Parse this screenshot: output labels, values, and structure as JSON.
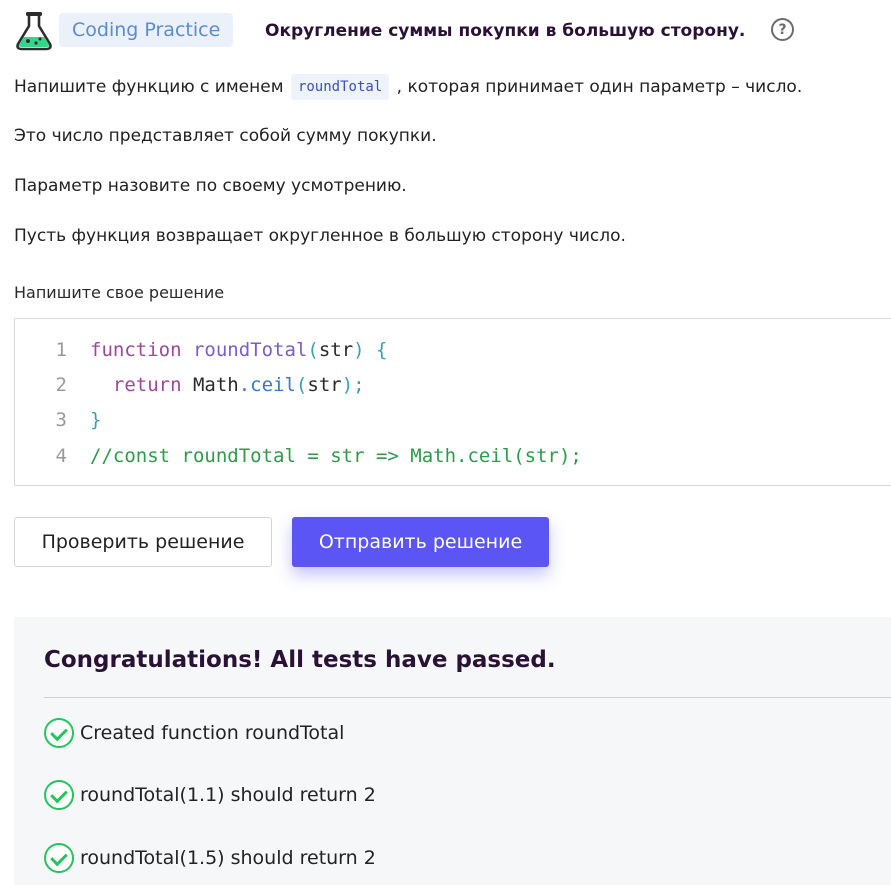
{
  "header": {
    "icon": "flask-icon",
    "tag": "Coding Practice",
    "title": "Округление суммы покупки в большую сторону.",
    "help": "?"
  },
  "description": {
    "line1_before": "Напишите функцию с именем",
    "line1_code": "roundTotal",
    "line1_after": ", которая принимает один параметр – число.",
    "line2": "Это число представляет собой сумму покупки.",
    "line3": "Параметр назовите по своему усмотрению.",
    "line4": "Пусть функция возвращает округленное в большую сторону число."
  },
  "editor": {
    "label": "Напишите свое решение",
    "lines": [
      {
        "num": "1",
        "tokens": [
          {
            "t": "function",
            "c": "kw"
          },
          {
            "t": " ",
            "c": "var"
          },
          {
            "t": "roundTotal",
            "c": "fn"
          },
          {
            "t": "(",
            "c": "pun"
          },
          {
            "t": "str",
            "c": "var"
          },
          {
            "t": ") {",
            "c": "pun"
          }
        ]
      },
      {
        "num": "2",
        "tokens": [
          {
            "t": "  return",
            "c": "kw"
          },
          {
            "t": " Math",
            "c": "var"
          },
          {
            "t": ".ceil",
            "c": "prop"
          },
          {
            "t": "(",
            "c": "pun"
          },
          {
            "t": "str",
            "c": "var"
          },
          {
            "t": ");",
            "c": "pun"
          }
        ]
      },
      {
        "num": "3",
        "tokens": [
          {
            "t": "}",
            "c": "pun"
          }
        ]
      },
      {
        "num": "4",
        "tokens": [
          {
            "t": "//const roundTotal = str => Math.ceil(str);",
            "c": "cm"
          }
        ]
      }
    ]
  },
  "buttons": {
    "check": "Проверить решение",
    "submit": "Отправить решение"
  },
  "results": {
    "title": "Congratulations! All tests have passed.",
    "tests": [
      "Created function roundTotal",
      "roundTotal(1.1) should return 2",
      "roundTotal(1.5) should return 2"
    ]
  },
  "colors": {
    "accent": "#5a55f4",
    "success": "#22c55e",
    "title": "#2a1236"
  }
}
